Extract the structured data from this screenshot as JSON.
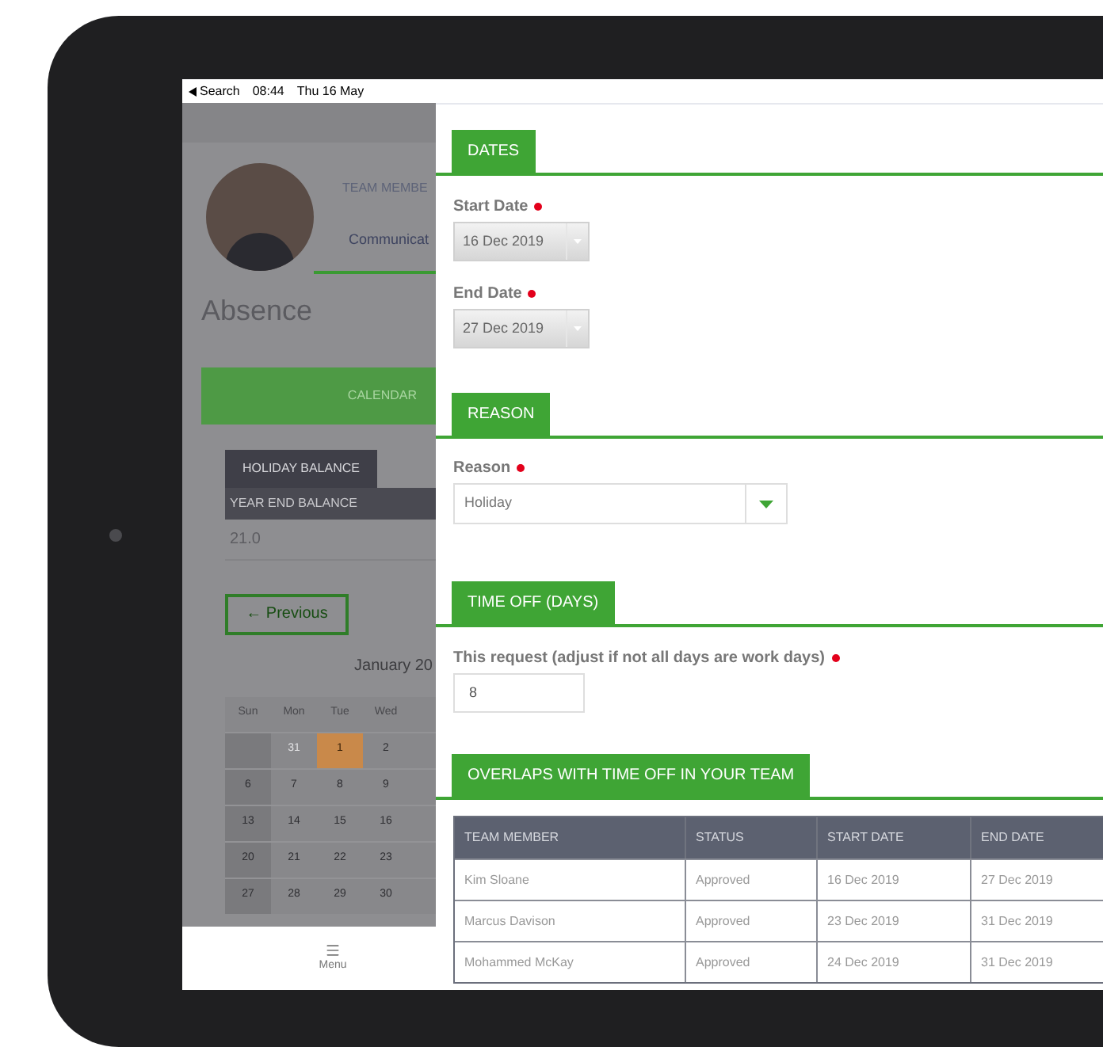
{
  "status_bar": {
    "back_label": "Search",
    "time": "08:44",
    "date": "Thu 16 May"
  },
  "profile": {
    "role": "TEAM MEMBE",
    "department": "Communicat"
  },
  "page_title": "Absence",
  "tabs": [
    {
      "label": "CALENDAR",
      "selected": true
    }
  ],
  "balance": {
    "tab": "HOLIDAY BALANCE",
    "header": "YEAR END BALANCE",
    "value": "21.0"
  },
  "calendar": {
    "previous": "← Previous",
    "month": "January 20",
    "weekdays": [
      "Sun",
      "Mon",
      "Tue",
      "Wed"
    ],
    "weeks": [
      [
        {
          "label": "31",
          "selected": false,
          "outside": true
        },
        {
          "label": "1",
          "selected": true,
          "outside": false
        },
        {
          "label": "2",
          "selected": false,
          "outside": false
        }
      ],
      [
        {
          "label": "6",
          "selected": false,
          "outside": false
        },
        {
          "label": "7",
          "selected": false,
          "outside": false
        },
        {
          "label": "8",
          "selected": false,
          "outside": false
        },
        {
          "label": "9",
          "selected": false,
          "outside": false
        }
      ],
      [
        {
          "label": "13",
          "selected": false,
          "outside": false
        },
        {
          "label": "14",
          "selected": false,
          "outside": false
        },
        {
          "label": "15",
          "selected": false,
          "outside": false
        },
        {
          "label": "16",
          "selected": false,
          "outside": false
        }
      ],
      [
        {
          "label": "20",
          "selected": false,
          "outside": false
        },
        {
          "label": "21",
          "selected": false,
          "outside": false
        },
        {
          "label": "22",
          "selected": false,
          "outside": false
        },
        {
          "label": "23",
          "selected": false,
          "outside": false
        }
      ],
      [
        {
          "label": "27",
          "selected": false,
          "outside": false
        },
        {
          "label": "28",
          "selected": false,
          "outside": false
        },
        {
          "label": "29",
          "selected": false,
          "outside": false
        },
        {
          "label": "30",
          "selected": false,
          "outside": false
        }
      ]
    ]
  },
  "bottom_nav": [
    {
      "label": "Menu"
    }
  ],
  "dates": {
    "tab": "DATES",
    "fields": [
      {
        "label": "Start Date",
        "required": true,
        "value": "16 Dec 2019"
      },
      {
        "label": "End Date",
        "required": true,
        "value": "27 Dec 2019"
      }
    ]
  },
  "reason": {
    "tab": "REASON",
    "label": "Reason",
    "required": true,
    "value": "Holiday"
  },
  "time_off": {
    "tab": "TIME OFF (DAYS)",
    "label": "This request (adjust if not all days are work days)",
    "required": true,
    "value": "8"
  },
  "overlaps": {
    "tab": "OVERLAPS WITH TIME OFF IN YOUR TEAM",
    "columns": [
      "TEAM MEMBER",
      "STATUS",
      "START DATE",
      "END DATE"
    ],
    "rows": [
      [
        "Kim Sloane",
        "Approved",
        "16 Dec 2019",
        "27 Dec 2019"
      ],
      [
        "Marcus Davison",
        "Approved",
        "23 Dec 2019",
        "31 Dec 2019"
      ],
      [
        "Mohammed McKay",
        "Approved",
        "24 Dec 2019",
        "31 Dec 2019"
      ]
    ]
  }
}
